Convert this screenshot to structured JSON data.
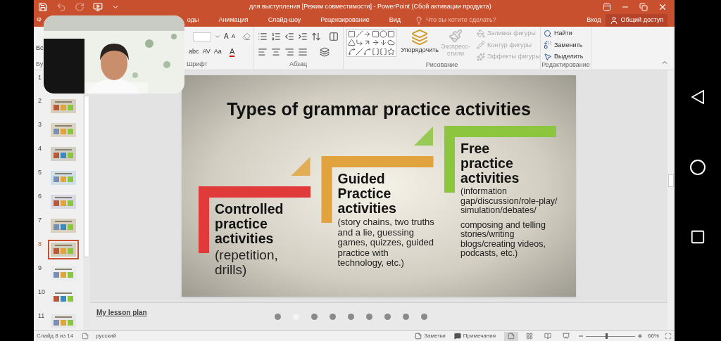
{
  "window": {
    "title": "для  выступления [Режим совместимости] - PowerPoint (Сбой активации продукта)"
  },
  "tabs": [
    {
      "label": "Ф",
      "selected": false
    },
    {
      "label": "оды",
      "selected": false
    },
    {
      "label": "Анимация",
      "selected": false
    },
    {
      "label": "Слайд-шоу",
      "selected": false
    },
    {
      "label": "Рецензирование",
      "selected": false
    },
    {
      "label": "Вид",
      "selected": false
    }
  ],
  "tell_me": {
    "placeholder": "Что вы хотите сделать?"
  },
  "sign_in": "Вход",
  "share": "Общий доступ",
  "ribbon": {
    "clipboard": {
      "paste": "Вс",
      "label": "Бу"
    },
    "font": {
      "label": "Шрифт",
      "grow": "A",
      "shrink": "A",
      "strikethrough": "abc",
      "spacing": "AV",
      "change_case": "Aa",
      "font_color": "A"
    },
    "paragraph": {
      "label": "Абзац"
    },
    "drawing": {
      "label": "Рисование",
      "arrange": "Упорядочить",
      "quick_styles": {
        "label": "Экспресс-стили",
        "disabled": true
      },
      "shape_format": [
        {
          "kind": "fill",
          "label": "Заливка фигуры",
          "disabled": true
        },
        {
          "kind": "outline",
          "label": "Контур фигуры",
          "disabled": true
        },
        {
          "kind": "effects",
          "label": "Эффекты фигуры",
          "disabled": true
        }
      ]
    },
    "editing": {
      "label": "Редактирование",
      "items": [
        {
          "kind": "find",
          "label": "Найти"
        },
        {
          "kind": "replace",
          "label": "Заменить"
        },
        {
          "kind": "select",
          "label": "Выделить"
        }
      ]
    }
  },
  "slides": [
    {
      "number": "1",
      "selected": false
    },
    {
      "number": "2",
      "selected": false
    },
    {
      "number": "3",
      "selected": false
    },
    {
      "number": "4",
      "selected": false
    },
    {
      "number": "5",
      "selected": false
    },
    {
      "number": "6",
      "selected": false
    },
    {
      "number": "7",
      "selected": false
    },
    {
      "number": "8",
      "selected": true
    },
    {
      "number": "9",
      "selected": false
    },
    {
      "number": "10",
      "selected": false
    },
    {
      "number": "11",
      "selected": false
    }
  ],
  "slide": {
    "title": "Types of grammar practice activities",
    "steps": [
      {
        "color": "#e03a3a",
        "heading": "Controlled practice activities",
        "details": [
          "(repetition, drills)"
        ]
      },
      {
        "color": "#e0a33e",
        "heading": "Guided Practice activities",
        "details": [
          "(story chains, two truths and a lie, guessing games, quizzes, guided practice with technology, etc.)"
        ]
      },
      {
        "color": "#8cc63f",
        "heading": "Free practice activities",
        "details": [
          "(information gap/discussion/role-play/ simulation/debates/",
          "composing and telling stories/writing blogs/creating videos, podcasts, etc.)"
        ]
      }
    ]
  },
  "notes": "My lesson plan",
  "page_dots": [
    {
      "selected": false
    },
    {
      "selected": true
    },
    {
      "selected": false
    },
    {
      "selected": false
    },
    {
      "selected": false
    },
    {
      "selected": false
    },
    {
      "selected": false
    },
    {
      "selected": false
    },
    {
      "selected": false
    }
  ],
  "status_bar": {
    "slide_position": "Слайд 8 из 14",
    "language": "русский",
    "notes": "Заметки",
    "comments": "Примечания",
    "views": [
      {
        "kind": "normal",
        "selected": true
      },
      {
        "kind": "sorter",
        "selected": false
      },
      {
        "kind": "reading",
        "selected": false
      },
      {
        "kind": "slideshow",
        "selected": false
      }
    ],
    "zoom": {
      "level": 0.4,
      "reading": "66%"
    }
  }
}
